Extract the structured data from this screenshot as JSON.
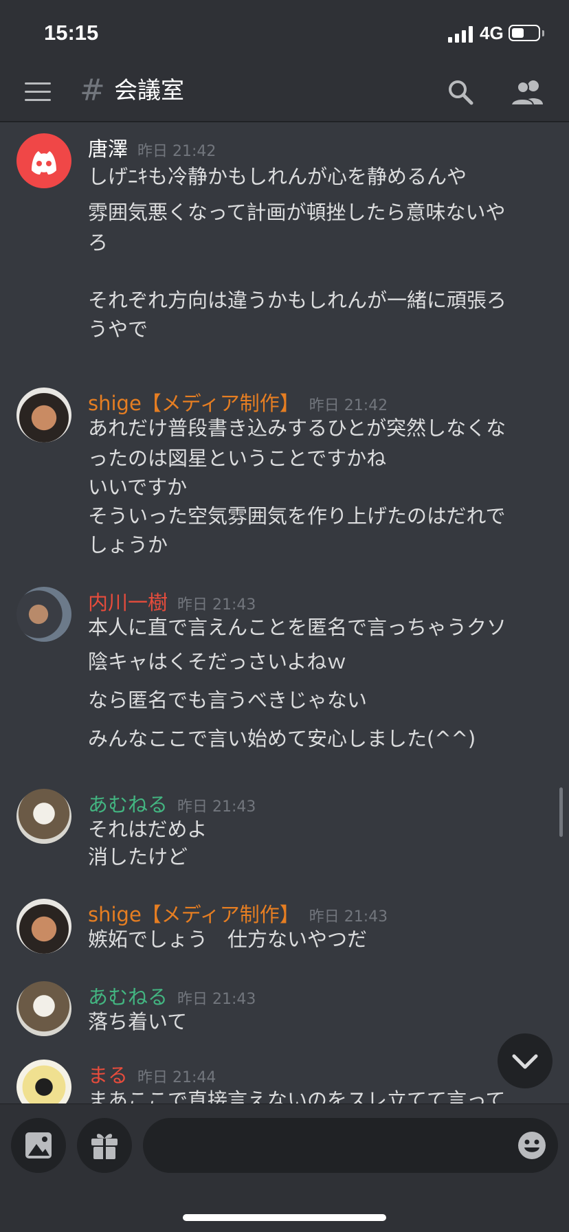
{
  "status_bar": {
    "time": "15:15",
    "network": "4G",
    "battery_level": 0.45
  },
  "header": {
    "channel_hash": "#",
    "channel_name": "会議室",
    "icons": [
      "menu-icon",
      "search-icon",
      "members-icon"
    ]
  },
  "colors": {
    "bg": "#36393f",
    "bar": "#2f3136",
    "shige": "#e67e22",
    "uchikawa": "#e74c3c",
    "amuneru": "#43b581",
    "maru": "#e74c3c",
    "karasawa": "#ffffff"
  },
  "messages": [
    {
      "user": "唐澤",
      "time": "昨日 21:42",
      "lines": [
        "しげﾆｷも冷静かもしれんが心を静めるんや",
        "雰囲気悪くなって計画が頓挫したら意味ないや",
        "ろ",
        "",
        "それぞれ方向は違うかもしれんが一緒に頑張ろ",
        "うやで"
      ]
    },
    {
      "user": "shige【メディア制作】",
      "time": "昨日 21:42",
      "lines": [
        "あれだけ普段書き込みするひとが突然しなくな",
        "ったのは図星ということですかね",
        "いいですか",
        "そういった空気雰囲気を作り上げたのはだれで",
        "しょうか"
      ]
    },
    {
      "user": "内川一樹",
      "time": "昨日 21:43",
      "lines": [
        "本人に直で言えんことを匿名で言っちゃうクソ",
        "陰キャはくそだっさいよねｗ",
        "なら匿名でも言うべきじゃない",
        "みんなここで言い始めて安心しました(^^)"
      ]
    },
    {
      "user": "あむねる",
      "time": "昨日 21:43",
      "lines": [
        "それはだめよ",
        "消したけど"
      ]
    },
    {
      "user": "shige【メディア制作】",
      "time": "昨日 21:43",
      "lines": [
        "嫉妬でしょう　仕方ないやつだ"
      ]
    },
    {
      "user": "あむねる",
      "time": "昨日 21:43",
      "lines": [
        "落ち着いて"
      ]
    },
    {
      "user": "まる",
      "time": "昨日 21:44",
      "lines": [
        "まあここで直接言えないのをスレ立てて言って"
      ]
    }
  ],
  "composer": {
    "placeholder": "",
    "icons": [
      "image-icon",
      "gift-icon",
      "emoji-icon"
    ]
  }
}
